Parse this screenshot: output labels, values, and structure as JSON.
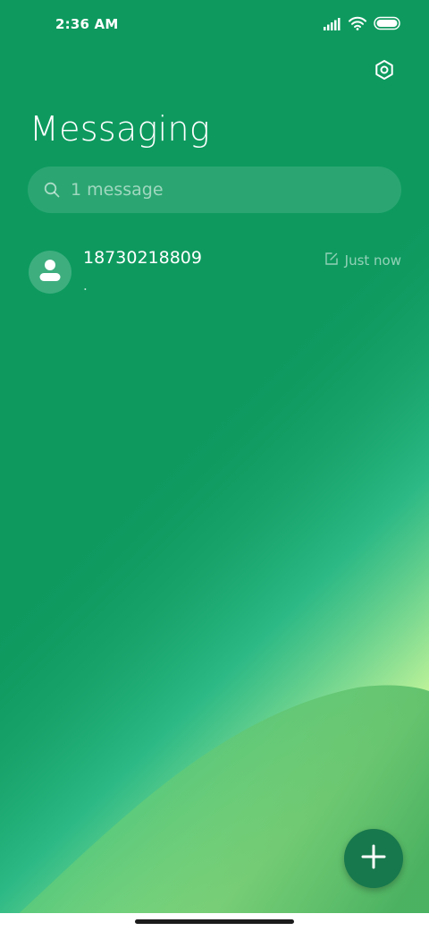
{
  "status_bar": {
    "time": "2:36 AM",
    "icons": [
      "signal-icon",
      "wifi-icon",
      "battery-icon"
    ]
  },
  "header": {
    "settings_icon": "settings-icon",
    "title": "Messaging"
  },
  "search": {
    "placeholder": "1 message",
    "icon": "search-icon"
  },
  "conversations": [
    {
      "avatar_icon": "person-icon",
      "name": "18730218809",
      "snippet": ".",
      "status_icon": "draft-edit-icon",
      "time": "Just now"
    }
  ],
  "fab": {
    "icon": "plus-icon"
  },
  "colors": {
    "background": "#0e9a5f",
    "fab": "#17784d",
    "accent_light": "#b9f08f"
  }
}
